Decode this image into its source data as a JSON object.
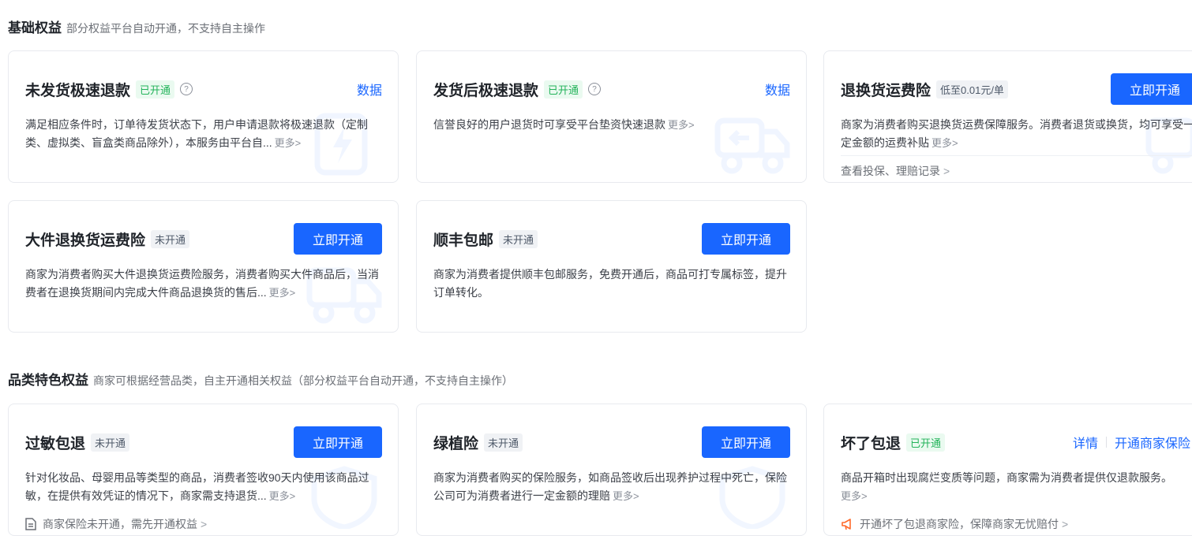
{
  "sections": [
    {
      "title": "基础权益",
      "subtitle": "部分权益平台自动开通，不支持自主操作"
    },
    {
      "title": "品类特色权益",
      "subtitle": "商家可根据经营品类，自主开通相关权益（部分权益平台自动开通，不支持自主操作）"
    }
  ],
  "cards": {
    "c1": {
      "name": "未发货极速退款",
      "badge": "已开通",
      "help": "?",
      "link": "数据",
      "desc": "满足相应条件时，订单待发货状态下，用户申请退款将极速退款（定制类、虚拟类、盲盒类商品除外），本服务由平台自...",
      "more": "更多>"
    },
    "c2": {
      "name": "发货后极速退款",
      "badge": "已开通",
      "help": "?",
      "link": "数据",
      "desc": "信誉良好的用户退货时可享受平台垫资快速退款",
      "more": "更多>"
    },
    "c3": {
      "name": "退换货运费险",
      "badge": "低至0.01元/单",
      "button": "立即开通",
      "desc": "商家为消费者购买退换货运费保障服务。消费者退货或换货，均可享受一定金额的运费补贴",
      "more": "更多>",
      "footer": "查看投保、理赔记录"
    },
    "c4": {
      "name": "大件退换货运费险",
      "badge": "未开通",
      "button": "立即开通",
      "desc": "商家为消费者购买大件退换货运费险服务，消费者购买大件商品后，当消费者在退换货期间内完成大件商品退换货的售后...",
      "more": "更多>"
    },
    "c5": {
      "name": "顺丰包邮",
      "badge": "未开通",
      "button": "立即开通",
      "desc": "商家为消费者提供顺丰包邮服务，免费开通后，商品可打专属标签，提升订单转化。"
    },
    "c6": {
      "name": "过敏包退",
      "badge": "未开通",
      "button": "立即开通",
      "desc": "针对化妆品、母婴用品等类型的商品，消费者签收90天内使用该商品过敏，在提供有效凭证的情况下，商家需支持退货...",
      "more": "更多>",
      "footer": "商家保险未开通，需先开通权益"
    },
    "c7": {
      "name": "绿植险",
      "badge": "未开通",
      "button": "立即开通",
      "desc": "商家为消费者购买的保险服务，如商品签收后出现养护过程中死亡，保险公司可为消费者进行一定金额的理赔",
      "more": "更多>"
    },
    "c8": {
      "name": "坏了包退",
      "badge": "已开通",
      "link": "详情",
      "link2": "开通商家保险",
      "desc": "商品开箱时出现腐烂变质等问题，商家需为消费者提供仅退款服务。",
      "more": "更多>",
      "footer": "开通坏了包退商家险，保障商家无忧赔付"
    }
  },
  "chevron": ">",
  "colors": {
    "primary": "#1966ff",
    "success": "#23b35a",
    "warning": "#ff6a2b"
  }
}
